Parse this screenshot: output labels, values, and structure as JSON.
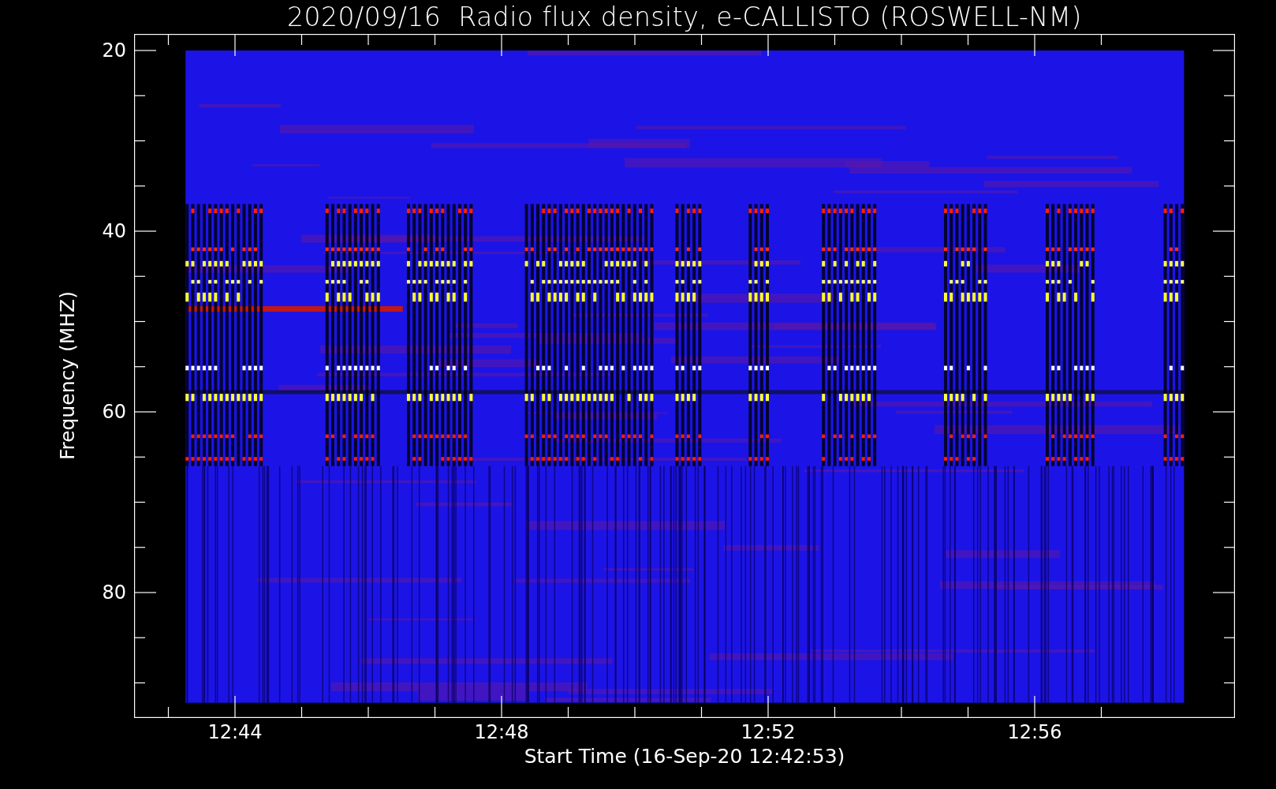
{
  "chart": {
    "title": "2020/09/16  Radio flux density, e-CALLISTO (ROSWELL-NM)",
    "y_axis": {
      "label": "Frequency (MHZ)",
      "ticks": [
        "20",
        "40",
        "60",
        "80"
      ]
    },
    "x_axis": {
      "label": "Start Time (16-Sep-20 12:42:53)",
      "ticks": [
        "12:44",
        "12:48",
        "12:52",
        "12:56"
      ]
    }
  }
}
